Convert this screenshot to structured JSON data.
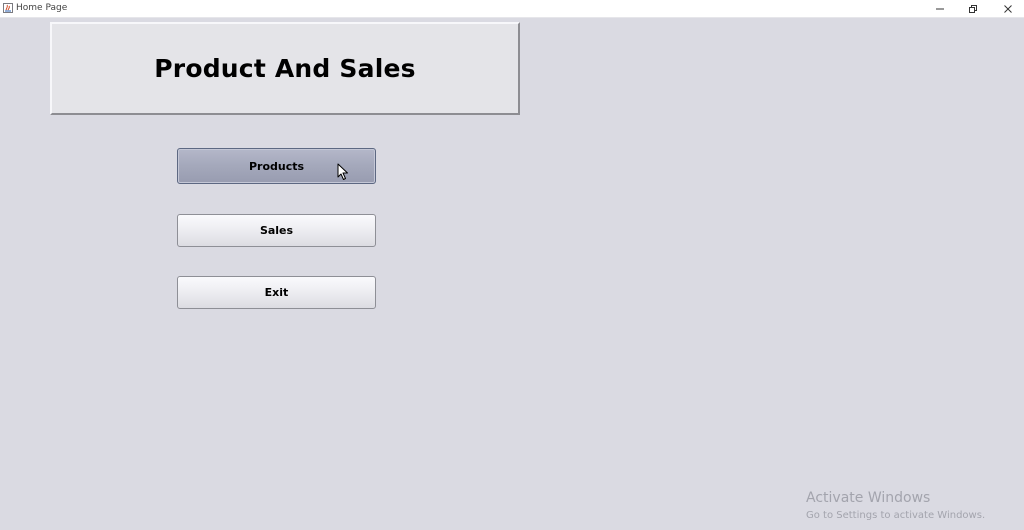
{
  "window": {
    "title": "Home Page",
    "controls": {
      "minimize_icon": "minimize-icon",
      "restore_icon": "restore-icon",
      "close_icon": "close-icon"
    }
  },
  "header": {
    "title": "Product And Sales"
  },
  "buttons": {
    "products": "Products",
    "sales": "Sales",
    "exit": "Exit"
  },
  "watermark": {
    "title": "Activate Windows",
    "subtitle": "Go to Settings to activate Windows."
  },
  "colors": {
    "background": "#dadae2",
    "pressed_button": "#a4a8bb",
    "watermark_text": "#a3a4ad"
  }
}
